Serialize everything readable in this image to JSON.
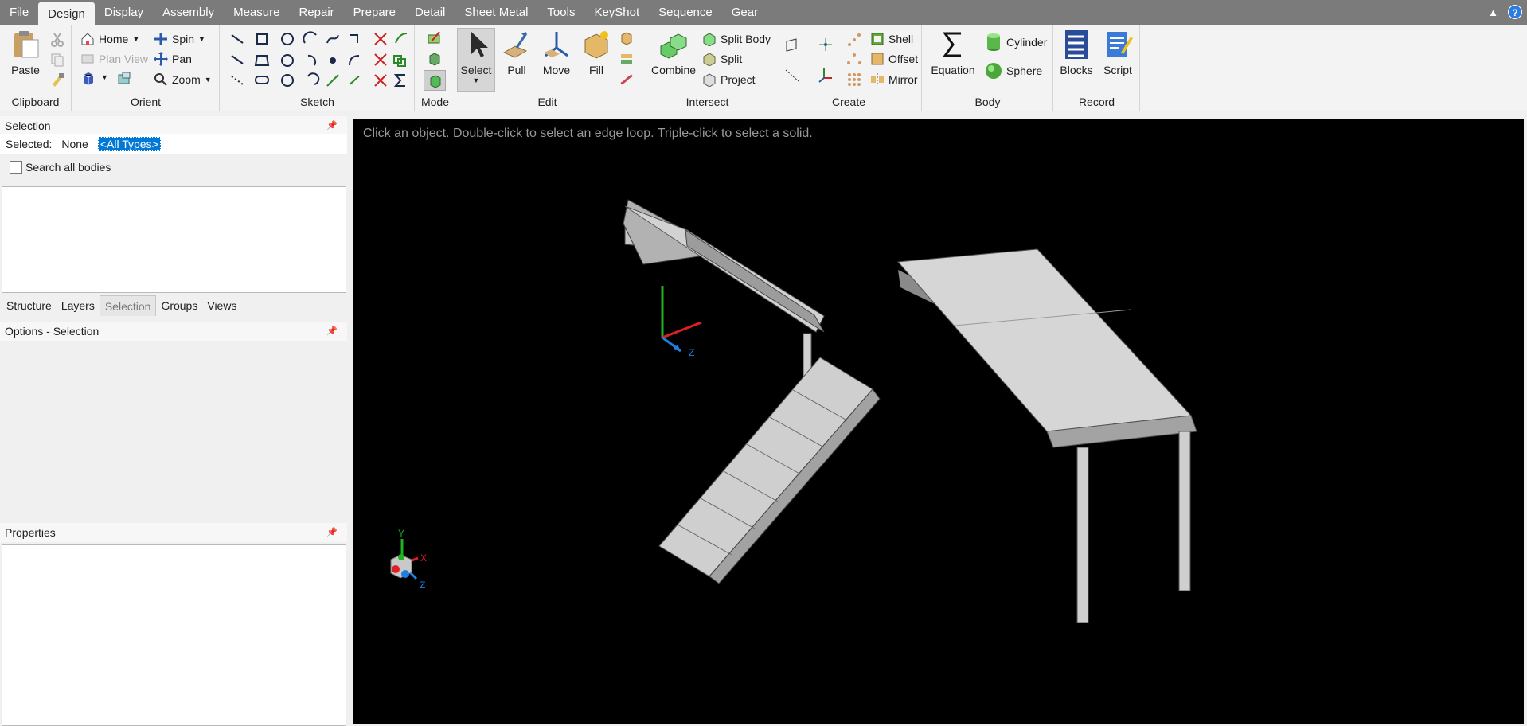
{
  "menu": {
    "tabs": [
      "File",
      "Design",
      "Display",
      "Assembly",
      "Measure",
      "Repair",
      "Prepare",
      "Detail",
      "Sheet Metal",
      "Tools",
      "KeyShot",
      "Sequence",
      "Gear"
    ],
    "active": "Design"
  },
  "ribbon": {
    "clipboard": {
      "label": "Clipboard",
      "paste": "Paste"
    },
    "orient": {
      "label": "Orient",
      "home": "Home",
      "plan_view": "Plan View",
      "spin": "Spin",
      "pan": "Pan",
      "zoom": "Zoom"
    },
    "sketch": {
      "label": "Sketch"
    },
    "mode": {
      "label": "Mode"
    },
    "edit": {
      "label": "Edit",
      "select": "Select",
      "pull": "Pull",
      "move": "Move",
      "fill": "Fill"
    },
    "intersect": {
      "label": "Intersect",
      "combine": "Combine",
      "split_body": "Split Body",
      "split": "Split",
      "project": "Project"
    },
    "create": {
      "label": "Create",
      "shell": "Shell",
      "offset": "Offset",
      "mirror": "Mirror"
    },
    "body": {
      "label": "Body",
      "equation": "Equation",
      "cylinder": "Cylinder",
      "sphere": "Sphere"
    },
    "record": {
      "label": "Record",
      "blocks": "Blocks",
      "script": "Script"
    }
  },
  "selection_panel": {
    "title": "Selection",
    "selected_label": "Selected:",
    "selected_value": "None",
    "type_filter": "<All Types>",
    "search_all_bodies": "Search all bodies"
  },
  "panel_tabs": [
    "Structure",
    "Layers",
    "Selection",
    "Groups",
    "Views"
  ],
  "panel_tabs_active": "Selection",
  "options_panel": {
    "title": "Options - Selection"
  },
  "properties_panel": {
    "title": "Properties"
  },
  "viewport": {
    "hint": "Click an object. Double-click to select an edge loop. Triple-click to select a solid.",
    "axis_x": "X",
    "axis_y": "Y",
    "axis_z": "Z"
  },
  "colors": {
    "menubar": "#7b7b7b",
    "ribbon": "#f3f3f3",
    "viewport": "#000000",
    "selection_highlight": "#0078d7",
    "axis_x": "#e02020",
    "axis_y": "#22b022",
    "axis_z": "#1f7fe0"
  }
}
